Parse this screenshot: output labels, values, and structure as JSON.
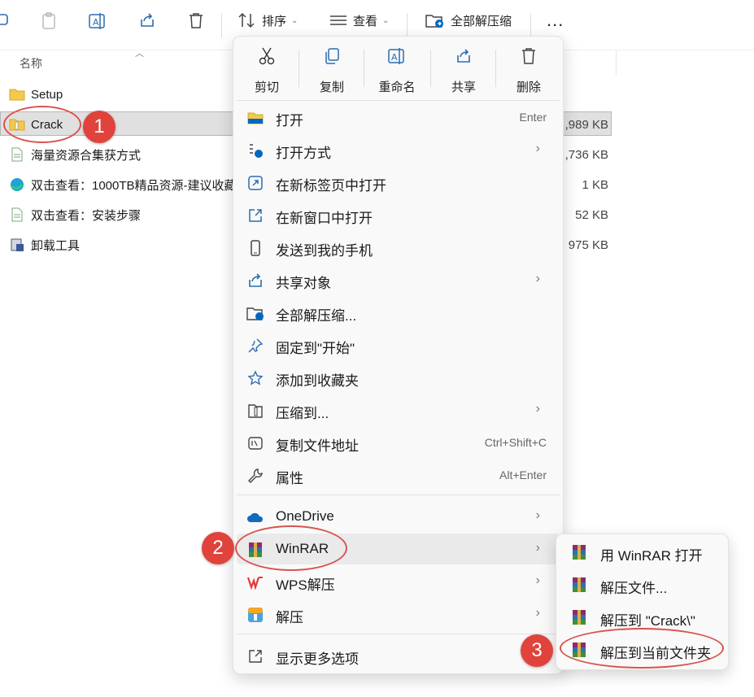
{
  "toolbar": {
    "sort_label": "排序",
    "view_label": "查看",
    "extract_all_label": "全部解压缩",
    "more_label": "..."
  },
  "header": {
    "name_col": "名称"
  },
  "files": [
    {
      "name": "Setup",
      "size": ""
    },
    {
      "name": "Crack",
      "size": ",989 KB"
    },
    {
      "name": "海量资源合集获方式",
      "size": ",736 KB"
    },
    {
      "name": "双击查看：1000TB精品资源-建议收藏",
      "size": "1 KB"
    },
    {
      "name": "双击查看：安装步骤",
      "size": "52 KB"
    },
    {
      "name": "卸载工具",
      "size": "975 KB"
    }
  ],
  "context_menu": {
    "quick_actions": [
      {
        "label": "剪切",
        "icon": "scissors-icon"
      },
      {
        "label": "复制",
        "icon": "copy-icon"
      },
      {
        "label": "重命名",
        "icon": "rename-icon"
      },
      {
        "label": "共享",
        "icon": "share-icon"
      },
      {
        "label": "删除",
        "icon": "trash-icon"
      }
    ],
    "items": [
      {
        "label": "打开",
        "shortcut": "Enter"
      },
      {
        "label": "打开方式",
        "arrow": "›"
      },
      {
        "label": "在新标签页中打开"
      },
      {
        "label": "在新窗口中打开"
      },
      {
        "label": "发送到我的手机"
      },
      {
        "label": "共享对象",
        "arrow": "›"
      },
      {
        "label": "全部解压缩..."
      },
      {
        "label": "固定到\"开始\""
      },
      {
        "label": "添加到收藏夹"
      },
      {
        "label": "压缩到...",
        "arrow": "›"
      },
      {
        "label": "复制文件地址",
        "shortcut": "Ctrl+Shift+C"
      },
      {
        "label": "属性",
        "shortcut": "Alt+Enter"
      },
      {
        "label": "OneDrive",
        "arrow": "›"
      },
      {
        "label": "WinRAR",
        "arrow": "›"
      },
      {
        "label": "WPS解压",
        "arrow": "›"
      },
      {
        "label": "解压",
        "arrow": "›"
      },
      {
        "label": "显示更多选项"
      }
    ]
  },
  "winrar_submenu": [
    {
      "label": "用 WinRAR 打开"
    },
    {
      "label": "解压文件..."
    },
    {
      "label": "解压到 \"Crack\\\""
    },
    {
      "label": "解压到当前文件夹"
    }
  ],
  "annotations": {
    "step1": "1",
    "step2": "2",
    "step3": "3"
  },
  "colors": {
    "accent": "#0067c0",
    "annotation_red": "#e0433b",
    "folder_yellow": "#f2c94c"
  }
}
